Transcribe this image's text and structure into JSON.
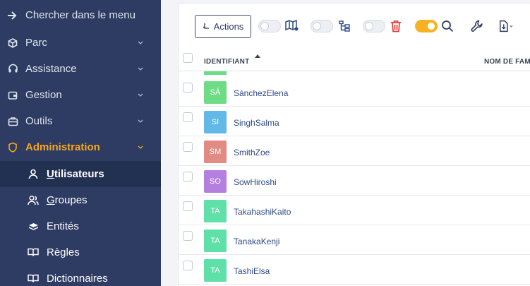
{
  "sidebar": {
    "search_label": "Chercher dans le menu",
    "items": [
      {
        "label": "Parc",
        "icon": "cube-icon"
      },
      {
        "label": "Assistance",
        "icon": "headset-icon"
      },
      {
        "label": "Gestion",
        "icon": "wallet-icon"
      },
      {
        "label": "Outils",
        "icon": "briefcase-icon"
      },
      {
        "label": "Administration",
        "icon": "shield-icon",
        "active": true
      }
    ],
    "sub_items": [
      {
        "label": "Utilisateurs",
        "icon": "user-icon",
        "selected": true
      },
      {
        "label": "Groupes",
        "icon": "users-icon"
      },
      {
        "label": "Entités",
        "icon": "stack-icon"
      },
      {
        "label": "Règles",
        "icon": "book-icon"
      },
      {
        "label": "Dictionnaires",
        "icon": "book-icon"
      }
    ],
    "colors": {
      "background": "#2e3b62",
      "active": "#f5a81c",
      "selected_bg": "#223051"
    }
  },
  "toolbar": {
    "actions_label": "Actions",
    "toggles": [
      {
        "name": "map-toggle",
        "on": false
      },
      {
        "name": "tree-toggle",
        "on": false
      },
      {
        "name": "trash-toggle",
        "on": false
      },
      {
        "name": "search-toggle",
        "on": true
      }
    ],
    "icons": [
      "map-icon",
      "tree-icon",
      "trash-icon",
      "search-icon",
      "wrench-icon",
      "export-icon"
    ]
  },
  "table": {
    "columns": [
      "IDENTIFIANT",
      "NOM DE FAM"
    ],
    "rows": [
      {
        "initials": "SÁ",
        "name": "SánchezElena",
        "color": "#6ddc85"
      },
      {
        "initials": "SI",
        "name": "SinghSalma",
        "color": "#62b8e6"
      },
      {
        "initials": "SM",
        "name": "SmithZoe",
        "color": "#e28a84"
      },
      {
        "initials": "SO",
        "name": "SowHiroshi",
        "color": "#b57fe0"
      },
      {
        "initials": "TA",
        "name": "TakahashiKaito",
        "color": "#5fe0a8"
      },
      {
        "initials": "TA",
        "name": "TanakaKenji",
        "color": "#5fe0a8"
      },
      {
        "initials": "TA",
        "name": "TashiElsa",
        "color": "#5fe0a8"
      }
    ]
  }
}
